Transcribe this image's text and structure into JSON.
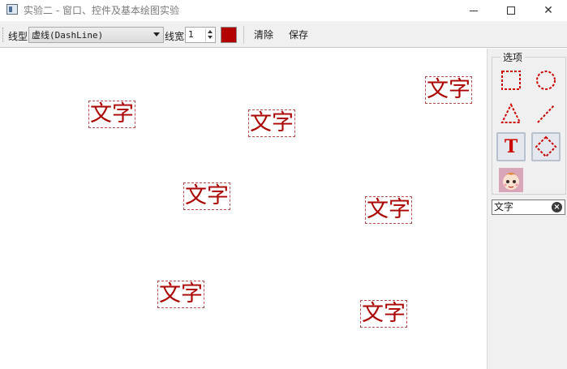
{
  "window": {
    "title": "实验二 - 窗口、控件及基本绘图实验",
    "min_glyph": "",
    "close_glyph": "✕"
  },
  "toolbar": {
    "line_type_label": "线型",
    "line_type_value": "虚线(DashLine)",
    "line_width_label": "线宽",
    "line_width_value": "1",
    "color": "#b30000",
    "clear_label": "清除",
    "save_label": "保存"
  },
  "canvas": {
    "text_color": "#aa0000",
    "items": [
      {
        "text": "文字"
      },
      {
        "text": "文字"
      },
      {
        "text": "文字"
      },
      {
        "text": "文字"
      },
      {
        "text": "文字"
      },
      {
        "text": "文字"
      },
      {
        "text": "文字"
      }
    ]
  },
  "dock": {
    "group_title": "选项",
    "tools": [
      {
        "name": "rectangle-tool",
        "icon": "dashed-square-icon",
        "checked": false
      },
      {
        "name": "ellipse-tool",
        "icon": "dashed-circle-icon",
        "checked": false
      },
      {
        "name": "triangle-tool",
        "icon": "dashed-triangle-icon",
        "checked": false
      },
      {
        "name": "line-tool",
        "icon": "dashed-line-icon",
        "checked": false
      },
      {
        "name": "text-tool",
        "icon": "text-t-icon",
        "checked": true,
        "glyph": "T"
      },
      {
        "name": "diamond-tool",
        "icon": "dashed-diamond-icon",
        "checked": true
      },
      {
        "name": "image-tool",
        "icon": "cartoon-face-icon",
        "checked": false
      }
    ],
    "text_input_value": "文字",
    "clear_input_glyph": "×"
  }
}
